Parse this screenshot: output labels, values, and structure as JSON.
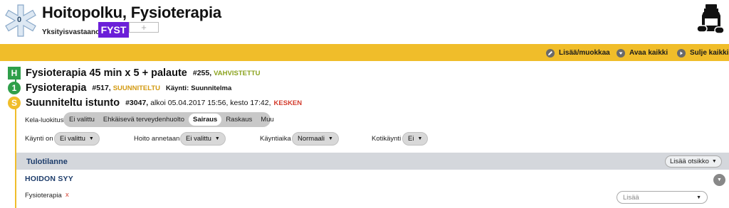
{
  "header": {
    "title": "Hoitopolku, Fysioterapia",
    "counter": "0",
    "responsible_label": "Yksityisvastaanotto",
    "badge": "FYST",
    "add_tag": "+",
    "icons": {
      "logo": "star-of-life-icon",
      "medication": "medication-bottle-icon"
    }
  },
  "toolbar": {
    "edit_label": "Lisää/muokkaa",
    "open_all_label": "Avaa kaikki",
    "close_all_label": "Sulje kaikki"
  },
  "path": {
    "h": {
      "marker": "H",
      "title": "Fysioterapia 45 min x 5 + palaute",
      "id": "#255,",
      "status": "VAHVISTETTU"
    },
    "p1": {
      "marker": "1",
      "title": "Fysioterapia",
      "id": "#517,",
      "status": "SUUNNITELTU",
      "visit_label": "Käynti:",
      "visit_value": "Suunnitelma"
    },
    "s": {
      "marker": "S",
      "title": "Suunniteltu istunto",
      "id": "#3047,",
      "details": "alkoi 05.04.2017 15:56, kesto 17:42,",
      "status": "KESKEN"
    }
  },
  "kela": {
    "label": "Kela-luokitus",
    "options": [
      "Ei valittu",
      "Ehkäisevä terveydenhuolto",
      "Sairaus",
      "Raskaus",
      "Muu"
    ],
    "selected": "Sairaus"
  },
  "fields": {
    "kaynti_on": {
      "label": "Käynti on",
      "value": "Ei valittu"
    },
    "hoito_annetaan": {
      "label": "Hoito annetaan",
      "value": "Ei valittu"
    },
    "kayntiaika": {
      "label": "Käyntiaika",
      "value": "Normaali"
    },
    "kotikaynti": {
      "label": "Kotikäynti",
      "value": "Ei"
    }
  },
  "section": {
    "title": "Tulotilanne",
    "add_heading_label": "Lisää otsikko",
    "subsection_title": "HOIDON SYY",
    "item_label": "Fysioterapia",
    "item_remove": "x",
    "add_select_placeholder": "Lisää"
  },
  "colors": {
    "accent_yellow": "#f0bd2a",
    "badge_purple": "#6b1fd8",
    "marker_green": "#2f9f4a",
    "status_confirmed": "#8aa21d",
    "status_planned": "#d39a11",
    "status_in_progress": "#d33b2c",
    "section_title": "#1e3d6b"
  }
}
